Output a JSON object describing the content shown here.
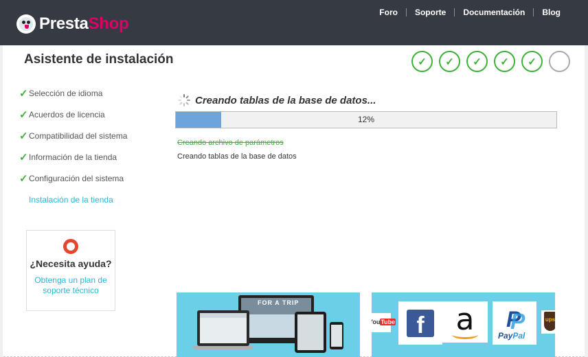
{
  "brand": {
    "name_main": "Presta",
    "name_accent": "Shop",
    "logo_icon": "puffin-logo-icon",
    "colors": {
      "header_bg": "#363a42",
      "accent_pink": "#df0067",
      "check_green": "#3fb039",
      "link_blue": "#25b9d7",
      "progress_fill": "#6ea4dd"
    }
  },
  "topnav": {
    "items": [
      {
        "label": "Foro"
      },
      {
        "label": "Soporte"
      },
      {
        "label": "Documentación"
      },
      {
        "label": "Blog"
      }
    ]
  },
  "page": {
    "title": "Asistente de instalación"
  },
  "steps_indicator": {
    "completed": 5,
    "total": 6,
    "check_glyph": "✓"
  },
  "sidebar": {
    "items": [
      {
        "label": "Selección de idioma",
        "status": "done"
      },
      {
        "label": "Acuerdos de licencia",
        "status": "done"
      },
      {
        "label": "Compatibilidad del sistema",
        "status": "done"
      },
      {
        "label": "Información de la tienda",
        "status": "done"
      },
      {
        "label": "Configuración del sistema",
        "status": "done"
      },
      {
        "label": "Instalación de la tienda",
        "status": "current"
      }
    ]
  },
  "help": {
    "title": "¿Necesita ayuda?",
    "link": "Obtenga un plan de soporte técnico",
    "icon": "lifebuoy-icon"
  },
  "install": {
    "heading": "Creando tablas de la base de datos...",
    "progress_fraction": 0.12,
    "progress_label": "12%",
    "log": [
      {
        "text": "Creando archivo de parámetros",
        "status": "done"
      },
      {
        "text": "Creando tablas de la base de datos",
        "status": "active"
      }
    ]
  },
  "banners": {
    "left": {
      "caption": "FOR A TRIP",
      "devices": [
        "laptop",
        "monitor",
        "tablet",
        "phone"
      ]
    },
    "right": {
      "logos": [
        "YouTube",
        "Facebook",
        "Amazon",
        "PayPal",
        "UPS"
      ],
      "youtube_left": "You",
      "youtube_right": "Tube",
      "facebook_glyph": "f",
      "amazon_glyph": "a",
      "paypal_glyph": "P",
      "paypal_left": "Pay",
      "paypal_right": "Pal",
      "ups_text": "ups"
    }
  }
}
